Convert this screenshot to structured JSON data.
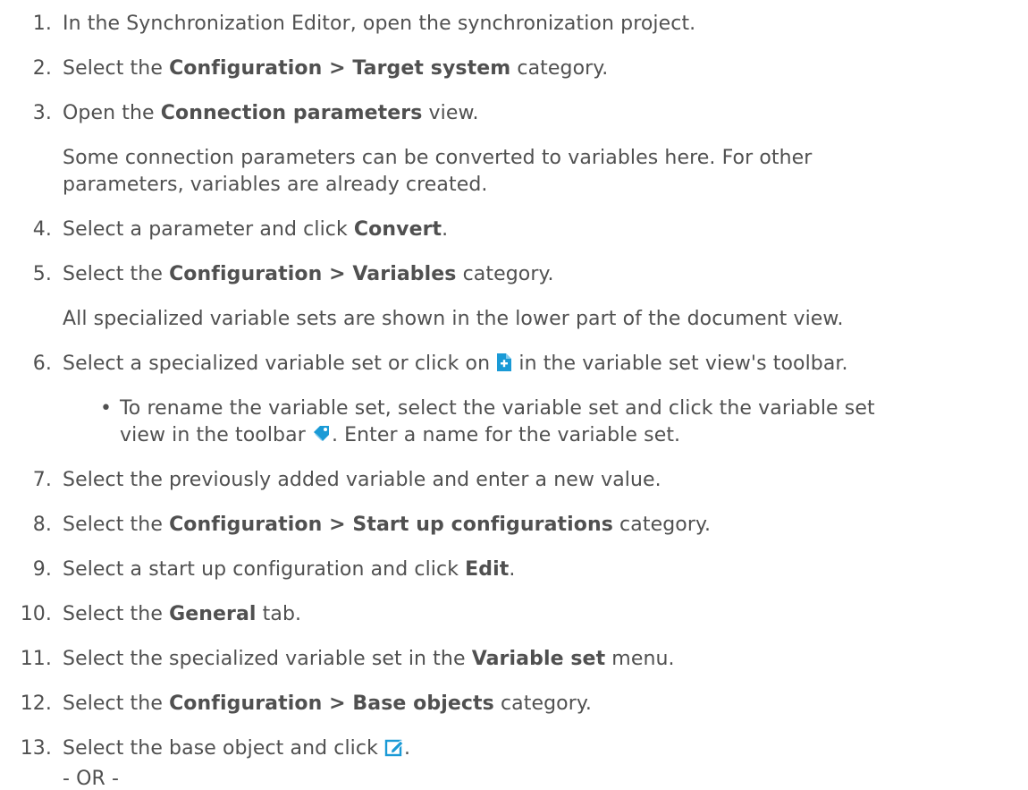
{
  "steps": [
    {
      "num": "1.",
      "pre": "In the Synchronization Editor, open the synchronization project."
    },
    {
      "num": "2.",
      "pre": "Select the ",
      "bold": "Configuration > Target system",
      "post": " category."
    },
    {
      "num": "3.",
      "pre": "Open the ",
      "bold": "Connection parameters",
      "post": " view."
    },
    {
      "num": "4.",
      "pre": "Select a parameter and click ",
      "bold": "Convert",
      "post": "."
    },
    {
      "num": "5.",
      "pre": "Select the ",
      "bold": "Configuration > Variables",
      "post": " category."
    },
    {
      "num": "6.",
      "pre": "Select a specialized variable set or click on ",
      "post": " in the variable set view's toolbar."
    },
    {
      "num": "7.",
      "pre": "Select the previously added variable and enter a new value."
    },
    {
      "num": "8.",
      "pre": "Select the ",
      "bold": "Configuration > Start up configurations",
      "post": " category."
    },
    {
      "num": "9.",
      "pre": "Select a start up configuration and click ",
      "bold": "Edit",
      "post": "."
    },
    {
      "num": "10.",
      "pre": "Select the ",
      "bold": "General",
      "post": " tab."
    },
    {
      "num": "11.",
      "pre": "Select the specialized variable set in the ",
      "bold": "Variable set",
      "post": " menu."
    },
    {
      "num": "12.",
      "pre": "Select the ",
      "bold": "Configuration > Base objects",
      "post": " category."
    },
    {
      "num": "13.",
      "pre": "Select the base object and click ",
      "post": "."
    }
  ],
  "notes": {
    "step3_line1": "Some connection parameters can be converted to variables here. For other",
    "step3_line2": "parameters, variables are already created.",
    "step5": "All specialized variable sets are shown in the lower part of the document view.",
    "step6_bullet_line1": "To rename the variable set, select the variable set and click the variable set",
    "step6_bullet_line2_pre": "view in the toolbar ",
    "step6_bullet_line2_post": ". Enter a name for the variable set.",
    "bullet_char": "•",
    "or": "- OR -"
  },
  "icons": {
    "add_variable_set": "add-variable-set-icon",
    "rename_tag": "rename-tag-icon",
    "edit": "edit-icon"
  },
  "colors": {
    "text": "#505050",
    "icon_blue": "#1a9ad6"
  }
}
